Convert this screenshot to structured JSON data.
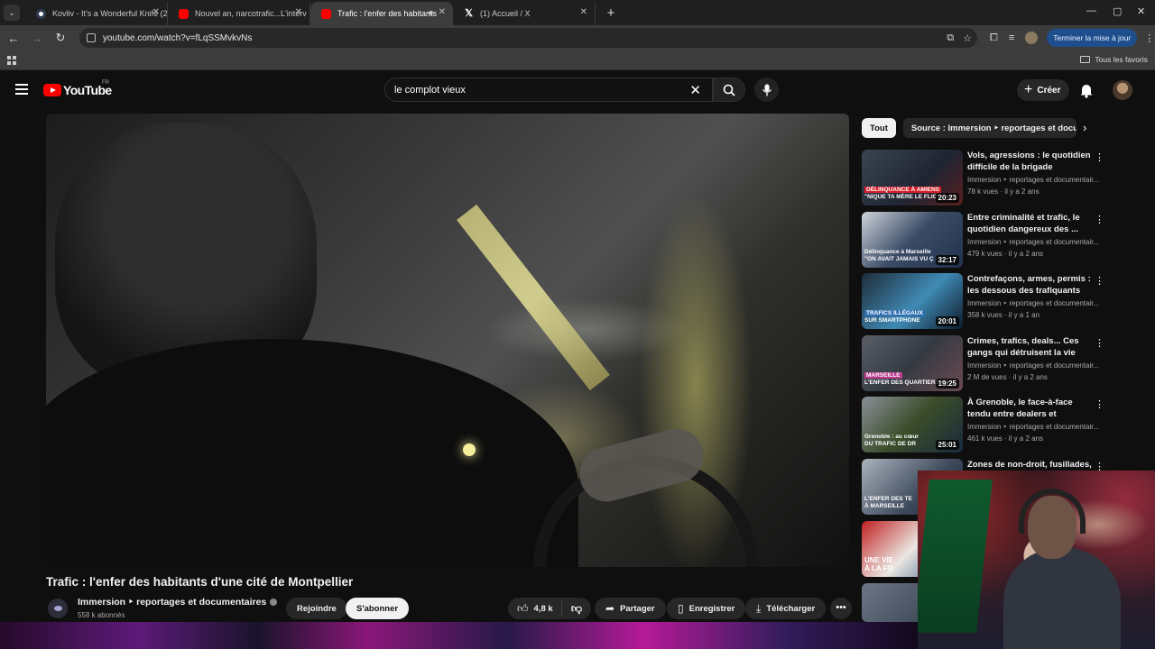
{
  "browser": {
    "tabs": [
      {
        "title": "Kovliv - It's a Wonderful Knife (2",
        "favicon": "globe-icon",
        "active": false
      },
      {
        "title": "Nouvel an, narcotrafic...L'interv",
        "favicon": "youtube-icon",
        "active": false
      },
      {
        "title": "Trafic : l'enfer des habitants",
        "favicon": "youtube-icon",
        "active": true,
        "audio": true
      },
      {
        "title": "(1) Accueil / X",
        "favicon": "x-icon",
        "active": false
      }
    ],
    "url": "youtube.com/watch?v=fLqSSMvkvNs",
    "update_button": "Terminer la mise à jour",
    "bookmarks_label": "Tous les favoris"
  },
  "youtube": {
    "logo_text": "YouTube",
    "country_code": "FR",
    "search_query": "le complot vieux",
    "create_label": "Créer"
  },
  "video": {
    "title": "Trafic : l'enfer des habitants d'une cité de Montpellier",
    "channel": "Immersion ‣ reportages et documentaires",
    "subscribers": "558 k abonnés",
    "join_label": "Rejoindre",
    "subscribe_label": "S'abonner",
    "likes": "4,8 k",
    "share_label": "Partager",
    "save_label": "Enregistrer",
    "download_label": "Télécharger"
  },
  "sidebar": {
    "chips": [
      "Tout",
      "Source : Immersion ‣ reportages et documentaires"
    ],
    "recommendations": [
      {
        "title": "Vols, agressions : le quotidien difficile de la brigade nocturne...",
        "channel": "Immersion ‣ reportages et documentair...",
        "meta": "78 k vues · il y a 2 ans",
        "duration": "20:23",
        "thumb_text_1": "DÉLINQUANCE À AMIENS",
        "thumb_text_2": "\"NIQUE TA MÈRE LE FLIC\""
      },
      {
        "title": "Entre criminalité et trafic, le quotidien dangereux des ...",
        "channel": "Immersion ‣ reportages et documentair...",
        "meta": "479 k vues · il y a 2 ans",
        "duration": "32:17",
        "thumb_text_1": "Délinquance à Marseille",
        "thumb_text_2": "\"ON AVAIT JAMAIS VU Ç"
      },
      {
        "title": "Contrefaçons, armes, permis : les dessous des trafiquants",
        "channel": "Immersion ‣ reportages et documentair...",
        "meta": "358 k vues · il y a 1 an",
        "duration": "20:01",
        "thumb_text_1": "TRAFICS ILLÉGAUX",
        "thumb_text_2": "SUR SMARTPHONE"
      },
      {
        "title": "Crimes, trafics, deals... Ces gangs qui détruisent la vie des...",
        "channel": "Immersion ‣ reportages et documentair...",
        "meta": "2 M de vues · il y a 2 ans",
        "duration": "19:25",
        "thumb_text_1": "MARSEILLE",
        "thumb_text_2": "L'ENFER DES QUARTIERS NO"
      },
      {
        "title": "À Grenoble, le face-à-face tendu entre dealers et policiers",
        "channel": "Immersion ‣ reportages et documentair...",
        "meta": "461 k vues · il y a 2 ans",
        "duration": "25:01",
        "thumb_text_1": "Grenoble : au cœur",
        "thumb_text_2": "DU TRAFIC DE DR"
      },
      {
        "title": "Zones de non-droit, fusillades,",
        "channel": "",
        "meta": "",
        "duration": "",
        "thumb_text_1": "L'ENFER DES TE",
        "thumb_text_2": "À MARSEILLE"
      },
      {
        "title": "",
        "channel": "",
        "meta": "",
        "duration": "",
        "thumb_text_1": "UNE VIE",
        "thumb_text_2": "À LA FO"
      },
      {
        "title": "",
        "channel": "",
        "meta": "",
        "duration": "",
        "thumb_text_1": "",
        "thumb_text_2": ""
      }
    ]
  },
  "colors": {
    "brand_red": "#ff0000",
    "background": "#0f0f0f",
    "chip_bg": "#272727",
    "update_blue": "#1e4e8c"
  }
}
